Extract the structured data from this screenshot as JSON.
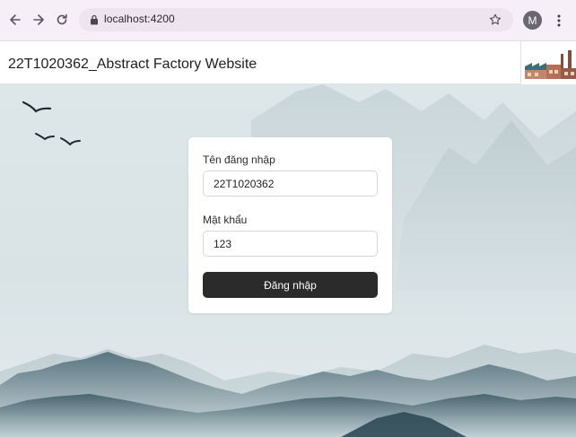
{
  "browser": {
    "url": "localhost:4200",
    "profile_initial": "M",
    "icons": {
      "back": "arrow-left-icon",
      "forward": "arrow-right-icon",
      "reload": "reload-icon",
      "lock": "lock-icon",
      "bookmark": "star-icon",
      "menu": "kebab-menu-icon"
    }
  },
  "header": {
    "title": "22T1020362_Abstract Factory Website",
    "logo": "factory-logo"
  },
  "login_form": {
    "username_label": "Tên đăng nhập",
    "username_value": "22T1020362",
    "password_label": "Mật khẩu",
    "password_value": "123",
    "submit_label": "Đăng nhập"
  },
  "colors": {
    "browser_chrome": "#f6eff8",
    "omnibox": "#ede4f0",
    "button": "#2b2b2b",
    "mountains": "#3f5d6a",
    "sky": "#dde6e8"
  }
}
